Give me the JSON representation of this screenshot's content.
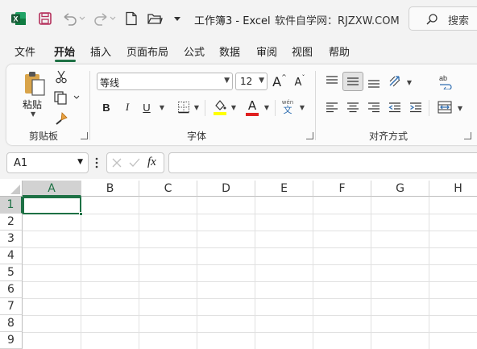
{
  "titlebar": {
    "title": "工作簿3  -  Excel",
    "watermark": "软件自学网：RJZXW.COM",
    "search_label": "搜索",
    "icons": [
      "excel-logo-icon",
      "save-icon",
      "undo-icon",
      "redo-icon",
      "new-file-icon",
      "open-folder-icon",
      "customize-qat-icon",
      "search-icon"
    ]
  },
  "tabs": [
    "文件",
    "开始",
    "插入",
    "页面布局",
    "公式",
    "数据",
    "审阅",
    "视图",
    "帮助"
  ],
  "active_tab": "开始",
  "ribbon": {
    "clipboard": {
      "paste_label": "粘贴",
      "group_label": "剪贴板"
    },
    "font": {
      "font_name": "等线",
      "font_size": "12",
      "group_label": "字体",
      "bold": "B",
      "italic": "I",
      "underline": "U",
      "grow": "A",
      "shrink": "A",
      "font_color": "A",
      "phonetic": "wén"
    },
    "alignment": {
      "group_label": "对齐方式"
    }
  },
  "formula_bar": {
    "name_box": "A1",
    "fx": "fx",
    "formula": ""
  },
  "sheet": {
    "columns": [
      "A",
      "B",
      "C",
      "D",
      "E",
      "F",
      "G",
      "H"
    ],
    "rows": [
      "1",
      "2",
      "3",
      "4",
      "5",
      "6",
      "7",
      "8",
      "9"
    ],
    "selected_cell": "A1"
  },
  "colors": {
    "accent": "#1e7145",
    "highlight": "#ffff00",
    "font_color": "#e02020"
  }
}
